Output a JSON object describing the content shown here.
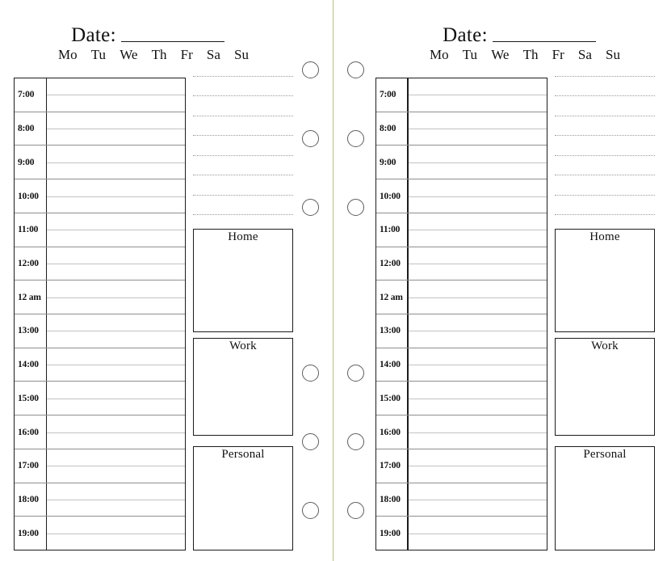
{
  "spread": {
    "divider_color": "#b9bd86",
    "ink_color": "#111111"
  },
  "header": {
    "date_label": "Date:",
    "date_value": ""
  },
  "weekdays": [
    "Mo",
    "Tu",
    "We",
    "Th",
    "Fr",
    "Sa",
    "Su"
  ],
  "schedule": {
    "times": [
      "7:00",
      "8:00",
      "9:00",
      "10:00",
      "11:00",
      "12:00",
      "12 am",
      "13:00",
      "14:00",
      "15:00",
      "16:00",
      "17:00",
      "18:00",
      "19:00"
    ]
  },
  "notes": {
    "line_count": 8,
    "lines": [
      "",
      "",
      "",
      "",
      "",
      "",
      "",
      ""
    ]
  },
  "categories": [
    {
      "title": "Home",
      "content": ""
    },
    {
      "title": "Work",
      "content": ""
    },
    {
      "title": "Personal",
      "content": ""
    }
  ],
  "ring_holes": {
    "count_per_column": 6,
    "y_positions": [
      87,
      172,
      257,
      462,
      547,
      632
    ]
  },
  "pages": [
    {
      "side": "left"
    },
    {
      "side": "right"
    }
  ]
}
